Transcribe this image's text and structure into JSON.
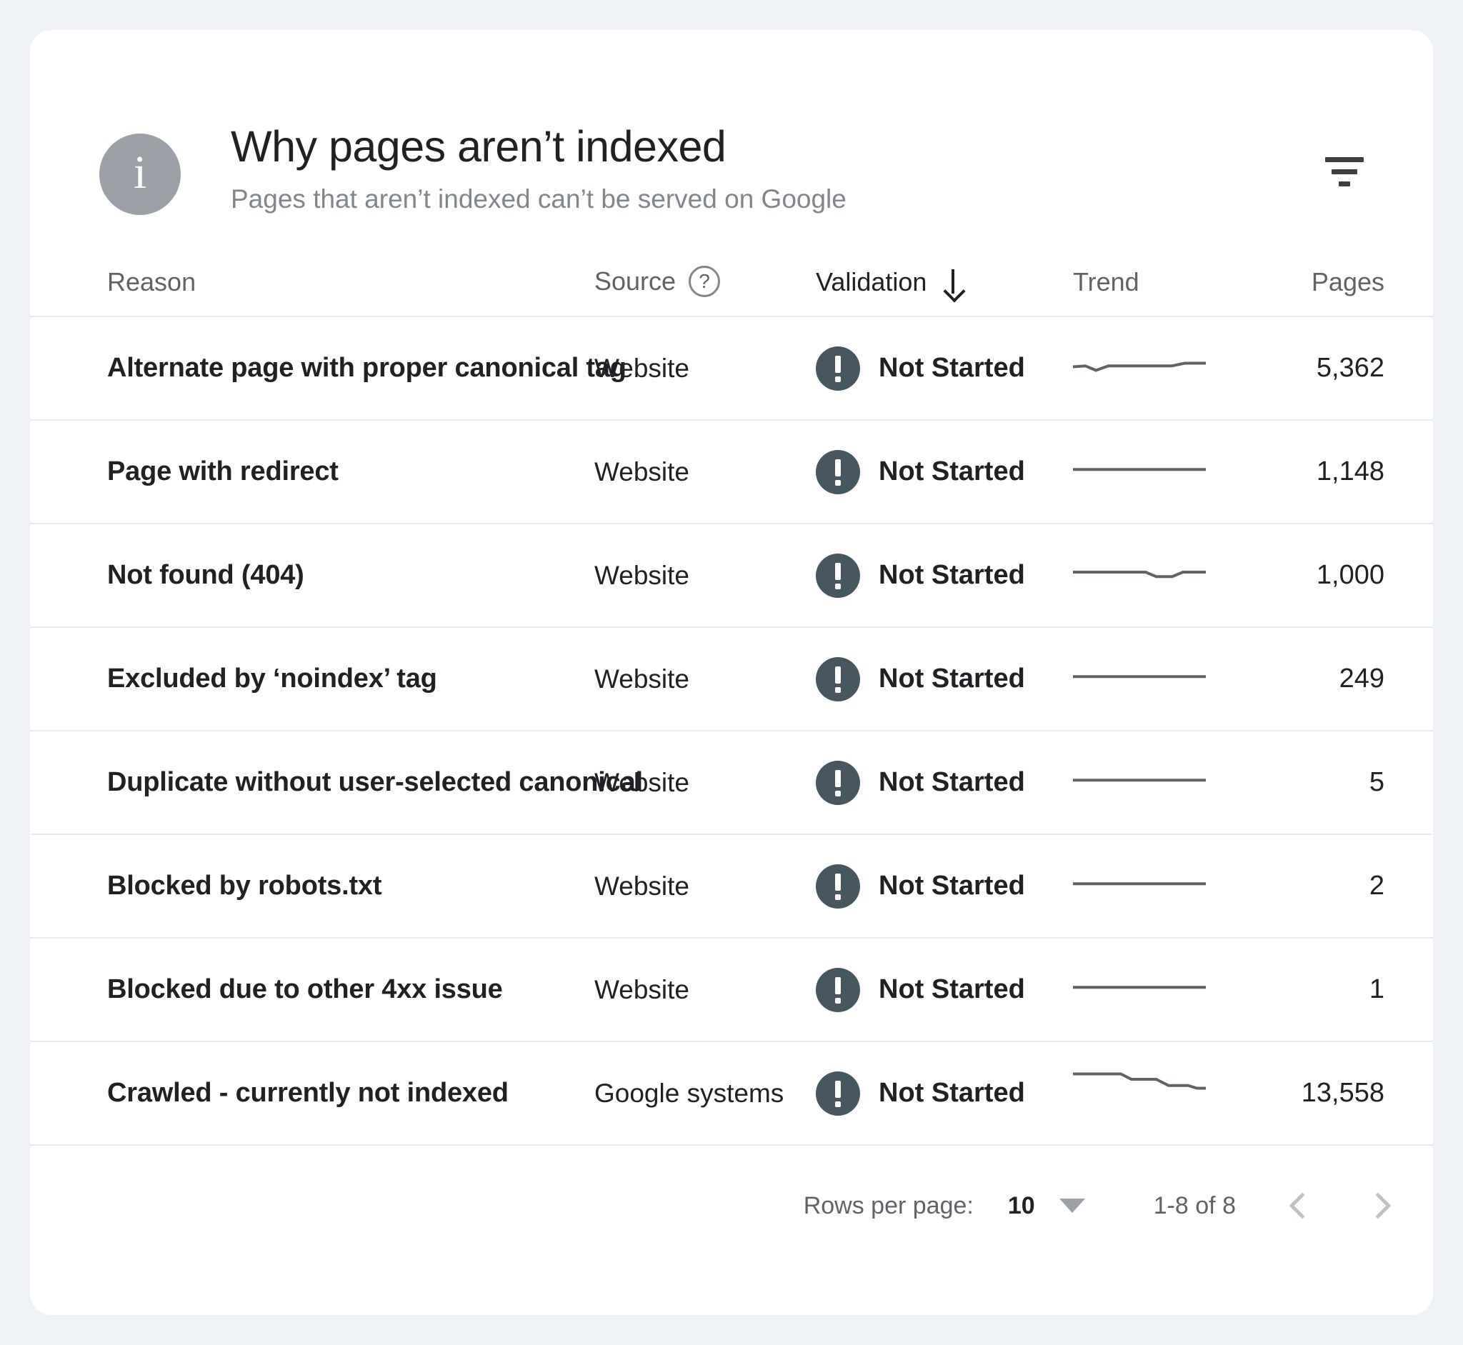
{
  "header": {
    "icon": "info-icon",
    "title": "Why pages aren’t indexed",
    "subtitle": "Pages that aren’t indexed can’t be served on Google",
    "filter_icon": "filter-icon"
  },
  "table": {
    "columns": {
      "reason": "Reason",
      "source": "Source",
      "source_help_icon": "?",
      "validation": "Validation",
      "validation_sort": "descending",
      "trend": "Trend",
      "pages": "Pages"
    },
    "rows": [
      {
        "reason": "Alternate page with proper canonical tag",
        "source": "Website",
        "validation": "Not Started",
        "status_icon": "exclamation-icon",
        "pages": "5,362",
        "trend": "0,26 14,25 26,30 40,25 112,25 126,22 150,22"
      },
      {
        "reason": "Page with redirect",
        "source": "Website",
        "validation": "Not Started",
        "status_icon": "exclamation-icon",
        "pages": "1,148",
        "trend": "0,25 150,25"
      },
      {
        "reason": "Not found (404)",
        "source": "Website",
        "validation": "Not Started",
        "status_icon": "exclamation-icon",
        "pages": "1,000",
        "trend": "0,24 82,24 94,29 112,29 124,24 150,24"
      },
      {
        "reason": "Excluded by ‘noindex’ tag",
        "source": "Website",
        "validation": "Not Started",
        "status_icon": "exclamation-icon",
        "pages": "249",
        "trend": "0,25 150,25"
      },
      {
        "reason": "Duplicate without user-selected canonical",
        "source": "Website",
        "validation": "Not Started",
        "status_icon": "exclamation-icon",
        "pages": "5",
        "trend": "0,25 150,25"
      },
      {
        "reason": "Blocked by robots.txt",
        "source": "Website",
        "validation": "Not Started",
        "status_icon": "exclamation-icon",
        "pages": "2",
        "trend": "0,25 150,25"
      },
      {
        "reason": "Blocked due to other 4xx issue",
        "source": "Website",
        "validation": "Not Started",
        "status_icon": "exclamation-icon",
        "pages": "1",
        "trend": "0,25 150,25"
      },
      {
        "reason": "Crawled - currently not indexed",
        "source": "Google systems",
        "validation": "Not Started",
        "status_icon": "exclamation-icon",
        "pages": "13,558",
        "trend": "0,6 54,6 66,12 94,12 108,19 130,19 140,22 150,22"
      }
    ]
  },
  "footer": {
    "rows_per_page_label": "Rows per page:",
    "rows_per_page_value": "10",
    "range": "1-8 of 8",
    "prev_icon": "chevron-left-icon",
    "next_icon": "chevron-right-icon"
  },
  "colors": {
    "page_background": "#eef1f6",
    "card_background": "#ffffff",
    "status_icon": "#47575f",
    "info_icon": "#9aa0a6",
    "divider": "#e8eaed",
    "text_primary": "#202124",
    "text_secondary": "#5f6368",
    "trend_line": "#5f6368"
  }
}
